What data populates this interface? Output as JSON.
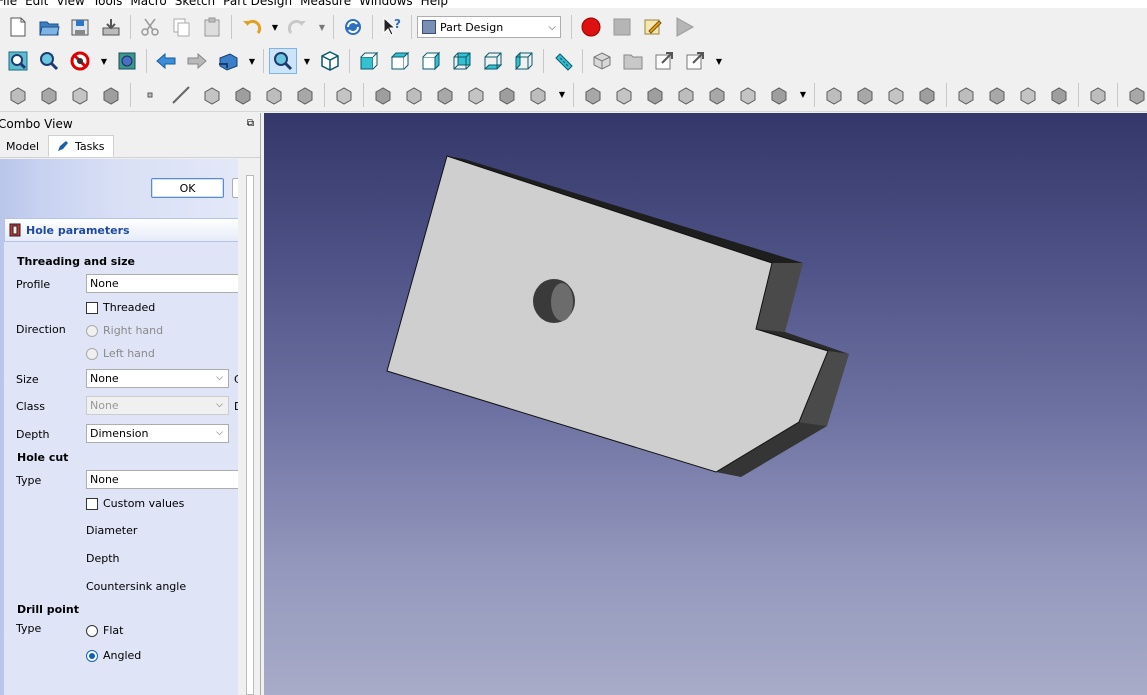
{
  "menu": [
    "File",
    "Edit",
    "View",
    "Tools",
    "Macro",
    "Sketch",
    "Part Design",
    "Measure",
    "Windows",
    "Help"
  ],
  "workbench": {
    "selected": "Part Design"
  },
  "toolbar_icons": {
    "row1": [
      "new-file-icon",
      "open-file-icon",
      "save-icon",
      "save-as-icon",
      "cut-icon",
      "copy-icon",
      "paste-icon",
      "undo-icon",
      "redo-icon",
      "refresh-icon",
      "whats-this-icon",
      "record-macro-icon",
      "stop-macro-icon",
      "edit-macro-icon",
      "run-macro-icon"
    ],
    "row2": [
      "fit-all-icon",
      "fit-selection-icon",
      "draw-style-icon",
      "bounding-box-icon",
      "back-icon",
      "forward-icon",
      "workbench-nav-icon",
      "zoom-icon",
      "isometric-icon",
      "front-view-icon",
      "top-view-icon",
      "right-view-icon",
      "rear-view-icon",
      "bottom-view-icon",
      "left-view-icon",
      "measure-icon",
      "part-icon",
      "group-icon",
      "link-icon",
      "link-actions-icon"
    ],
    "row3": [
      "body-icon",
      "create-sketch-icon",
      "validate-sketch-icon",
      "shape-binder-icon",
      "datum-point-icon",
      "datum-line-icon",
      "datum-plane-icon",
      "local-cs-icon",
      "clone-icon",
      "subshape-binder-icon",
      "sprocket-icon",
      "pad-icon",
      "revolution-icon",
      "loft-icon",
      "pipe-icon",
      "helix-icon",
      "additive-primitive-icon",
      "pocket-icon",
      "hole-icon",
      "groove-icon",
      "subtractive-loft-icon",
      "subtractive-pipe-icon",
      "subtractive-helix-icon",
      "subtractive-primitive-icon",
      "mirrored-icon",
      "linear-pattern-icon",
      "polar-pattern-icon",
      "multi-transform-icon",
      "fillet-icon",
      "chamfer-icon",
      "draft-icon",
      "thickness-icon",
      "boolean-icon",
      "measure-linear-icon",
      "measure-angular-icon"
    ]
  },
  "combo": {
    "title": "Combo View",
    "tabs": {
      "model": "Model",
      "tasks": "Tasks"
    },
    "ok_label": "OK"
  },
  "hole": {
    "header": "Hole parameters",
    "threading_section": "Threading and size",
    "profile_label": "Profile",
    "profile_value": "None",
    "threaded_label": "Threaded",
    "direction_label": "Direction",
    "right_hand": "Right hand",
    "left_hand": "Left hand",
    "size_label": "Size",
    "size_value": "None",
    "class_label": "Class",
    "class_value": "None",
    "depth_label": "Depth",
    "depth_value": "Dimension",
    "holecut_section": "Hole cut",
    "type_label": "Type",
    "holecut_type_value": "None",
    "custom_values": "Custom values",
    "diameter_label": "Diameter",
    "hc_depth_label": "Depth",
    "countersink_label": "Countersink angle",
    "drill_section": "Drill point",
    "drill_type_label": "Type",
    "flat": "Flat",
    "angled": "Angled",
    "cut_c": "C",
    "cut_d": "D"
  }
}
